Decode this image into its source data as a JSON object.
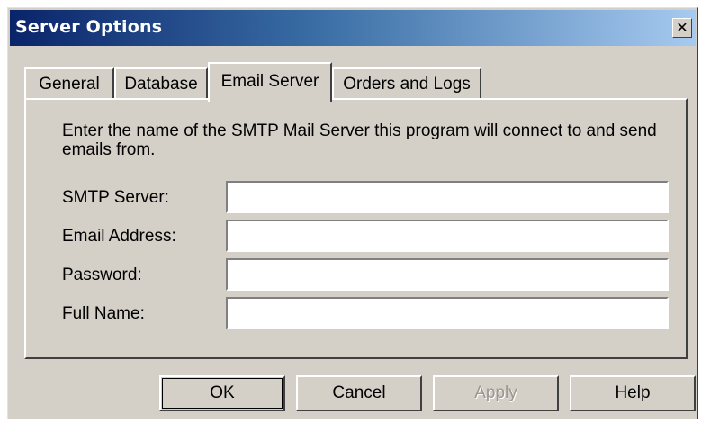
{
  "window": {
    "title": "Server Options",
    "close_glyph": "✕"
  },
  "tabs": [
    {
      "label": "General",
      "active": false
    },
    {
      "label": "Database",
      "active": false
    },
    {
      "label": "Email Server",
      "active": true
    },
    {
      "label": "Orders and Logs",
      "active": false
    }
  ],
  "panel": {
    "description": "Enter the name of the SMTP Mail Server this program will connect to and send emails from.",
    "fields": [
      {
        "label": "SMTP Server:",
        "value": ""
      },
      {
        "label": "Email Address:",
        "value": ""
      },
      {
        "label": "Password:",
        "value": ""
      },
      {
        "label": "Full Name:",
        "value": ""
      }
    ]
  },
  "buttons": {
    "ok": "OK",
    "cancel": "Cancel",
    "apply": "Apply",
    "help": "Help"
  },
  "colors": {
    "face": "#d4d0c8",
    "title_start": "#0a246a",
    "title_end": "#a6caf0"
  }
}
